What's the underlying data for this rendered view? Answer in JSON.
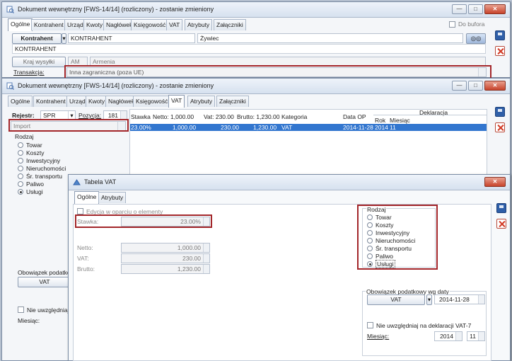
{
  "win1": {
    "title": "Dokument wewnętrzny [FWS-14/14] (rozliczony) - zostanie zmieniony",
    "tabs": [
      "Ogólne",
      "Kontrahent",
      "Urząd",
      "Kwoty",
      "Nagłówek",
      "Księgowość",
      "VAT",
      "Atrybuty",
      "Załączniki"
    ],
    "do_bufora": "Do bufora",
    "kontrahent_btn": "Kontrahent",
    "kontrahent_code": "KONTRAHENT",
    "kontrahent_city": "Żywiec",
    "kontrahent_name": "KONTRAHENT",
    "kraj_btn": "Kraj wysyłki",
    "kraj_code": "AM",
    "kraj_name": "Armenia",
    "transakcja_label": "Transakcja:",
    "transakcja_value": "Inna zagraniczna (poza UE)"
  },
  "win2": {
    "title": "Dokument wewnętrzny [FWS-14/14] (rozliczony) - zostanie zmieniony",
    "tabs": [
      "Ogólne",
      "Kontrahent",
      "Urząd",
      "Kwoty",
      "Nagłówek",
      "Księgowość",
      "VAT",
      "Atrybuty",
      "Załączniki"
    ],
    "rejestr_label": "Rejestr:",
    "rejestr_value": "SPR",
    "pozycja_label": "Pozycja:",
    "pozycja_value": "181",
    "import_value": "Import",
    "rodzaj_title": "Rodzaj",
    "rodzaj_items": [
      "Towar",
      "Koszty",
      "Inwestycyjny",
      "Nieruchomości",
      "Śr. transportu",
      "Paliwo",
      "Usługi"
    ],
    "rodzaj_selected": "Usługi",
    "obowiazek_label": "Obowiązek podatkow",
    "obowiazek_btn": "VAT",
    "nie_uwzgl": "Nie uwzględniaj na",
    "miesiac_label": "Miesiąc:",
    "grid_headers": {
      "stawka": "Stawka",
      "netto": "Netto: 1,000.00",
      "vat": "Vat: 230.00",
      "brutto": "Brutto: 1,230.00",
      "kategoria": "Kategoria",
      "data_op": "Data OP",
      "deklaracja": "Deklaracja",
      "rok": "Rok",
      "miesiac": "Miesiąc"
    },
    "row": {
      "stawka": "23.00%",
      "netto": "1,000.00",
      "vat": "230.00",
      "brutto": "1,230.00",
      "kategoria": "VAT",
      "data_op": "2014-11-28",
      "rok": "2014",
      "miesiac": "11"
    }
  },
  "win3": {
    "title": "Tabela VAT",
    "tabs": [
      "Ogólne",
      "Atrybuty"
    ],
    "edycja_label": "Edycja w oparciu o elementy",
    "stawka_label": "Stawka:",
    "stawka_value": "23.00%",
    "netto_label": "Netto:",
    "netto_value": "1,000.00",
    "vat_label": "VAT:",
    "vat_value": "230.00",
    "brutto_label": "Brutto:",
    "brutto_value": "1,230.00",
    "rodzaj_title": "Rodzaj",
    "rodzaj_items": [
      "Towar",
      "Koszty",
      "Inwestycyjny",
      "Nieruchomości",
      "Śr. transportu",
      "Paliwo",
      "Usługi"
    ],
    "rodzaj_selected": "Usługi",
    "obowiazek_title": "Obowiązek podatkowy wg daty",
    "obowiazek_btn": "VAT",
    "obowiazek_date": "2014-11-28",
    "nie_uwzgl": "Nie uwzględniaj na deklaracji VAT-7",
    "miesiac_label": "Miesiąc:",
    "miesiac_year": "2014",
    "miesiac_month": "11"
  },
  "colors": {
    "accent_red": "#a3262a",
    "selection_blue": "#3276cf",
    "title_gradient_top": "#eef3fa"
  }
}
